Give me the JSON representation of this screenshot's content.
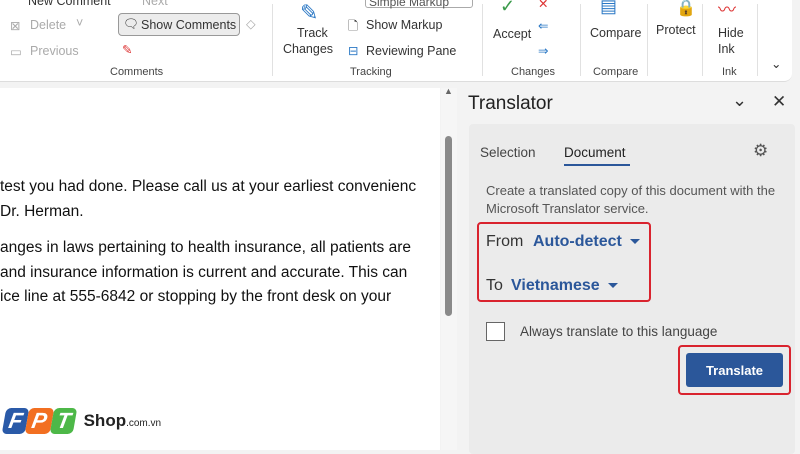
{
  "ribbon": {
    "new_comment": "New Comment",
    "next": "Next",
    "delete": "Delete",
    "previous": "Previous",
    "show_comments": "Show Comments",
    "comments_group": "Comments",
    "track_changes_1": "Track",
    "track_changes_2": "Changes",
    "simple_markup": "Simple Markup",
    "show_markup": "Show Markup",
    "reviewing_pane": "Reviewing Pane",
    "tracking_group": "Tracking",
    "accept": "Accept",
    "changes_group": "Changes",
    "compare": "Compare",
    "compare_group": "Compare",
    "protect": "Protect",
    "hide_ink_1": "Hide",
    "hide_ink_2": "Ink",
    "ink_group": "Ink"
  },
  "document": {
    "lines": [
      "test you had done. Please call us at your earliest convenienc",
      "Dr. Herman.",
      "anges in laws pertaining to health insurance, all patients are",
      "and insurance information is current and accurate. This can",
      "ice line at 555-6842 or stopping by the front desk on your"
    ]
  },
  "translator": {
    "title": "Translator",
    "tab_selection": "Selection",
    "tab_document": "Document",
    "description": "Create a translated copy of this document with the Microsoft Translator service.",
    "from_label": "From",
    "from_value": "Auto-detect",
    "to_label": "To",
    "to_value": "Vietnamese",
    "always_translate": "Always translate to this language",
    "always_checked": false,
    "translate_button": "Translate"
  },
  "watermark": {
    "brand": "FPT",
    "shop": "Shop",
    ".suffix": ".com.vn"
  },
  "colors": {
    "accent": "#2b579a",
    "highlight": "#d9232e"
  }
}
